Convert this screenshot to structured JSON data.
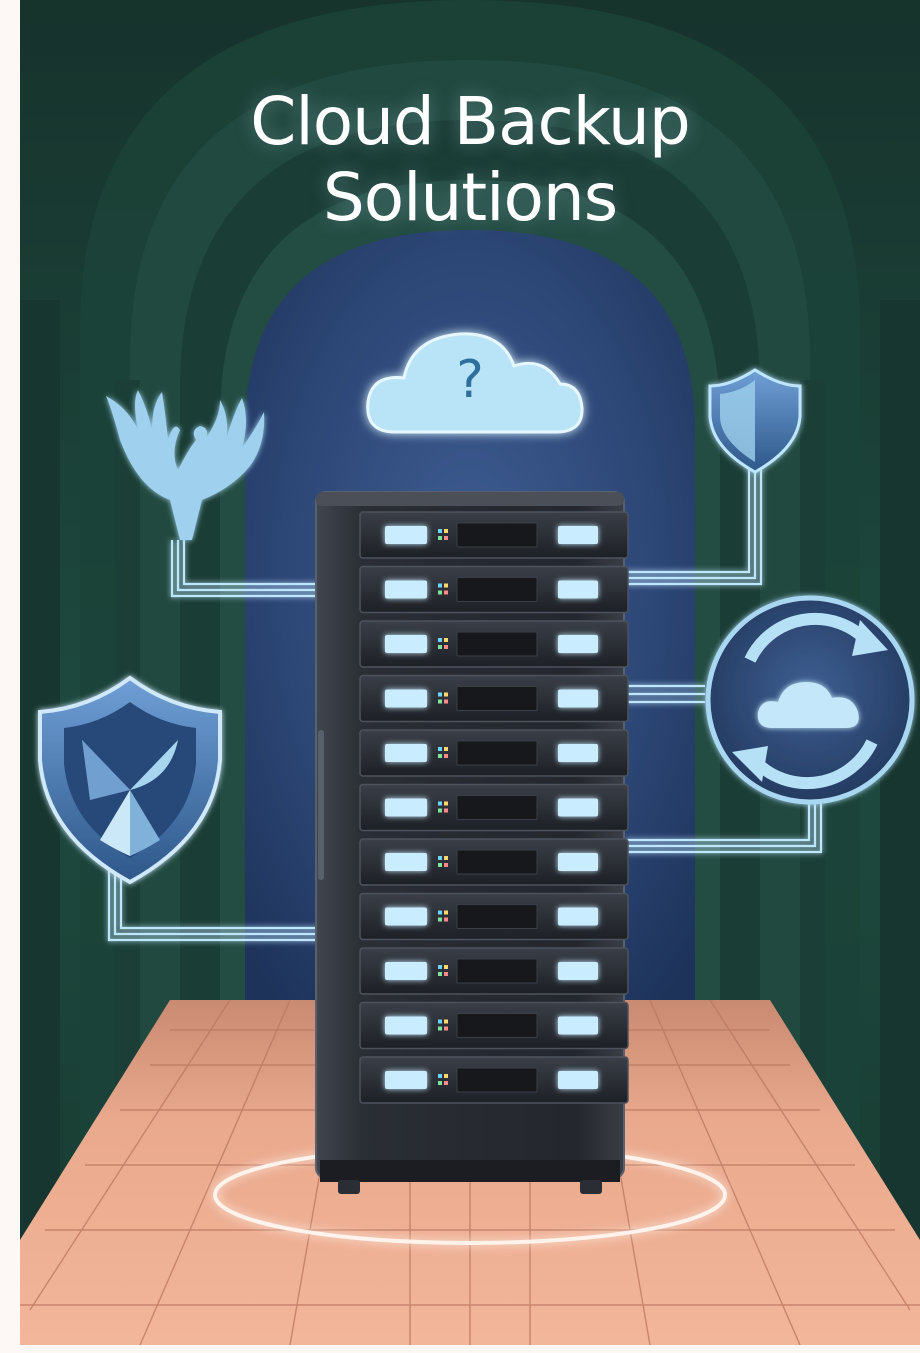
{
  "poster": {
    "title_line1": "Cloud Backup",
    "title_line2": "Solutions",
    "cloud_symbol": "?"
  },
  "icons": {
    "top_left": "phoenix-icon",
    "top_center": "cloud-question-icon",
    "top_right": "shield-icon",
    "left": "shield-emblem-icon",
    "right": "cloud-sync-icon",
    "center": "server-rack-icon"
  },
  "colors": {
    "arch": "#1f4a40",
    "back_wall": "#2f4a7a",
    "floor": "#e8a98c",
    "glow": "#9fd6f2",
    "rack": "#2b2f36"
  }
}
